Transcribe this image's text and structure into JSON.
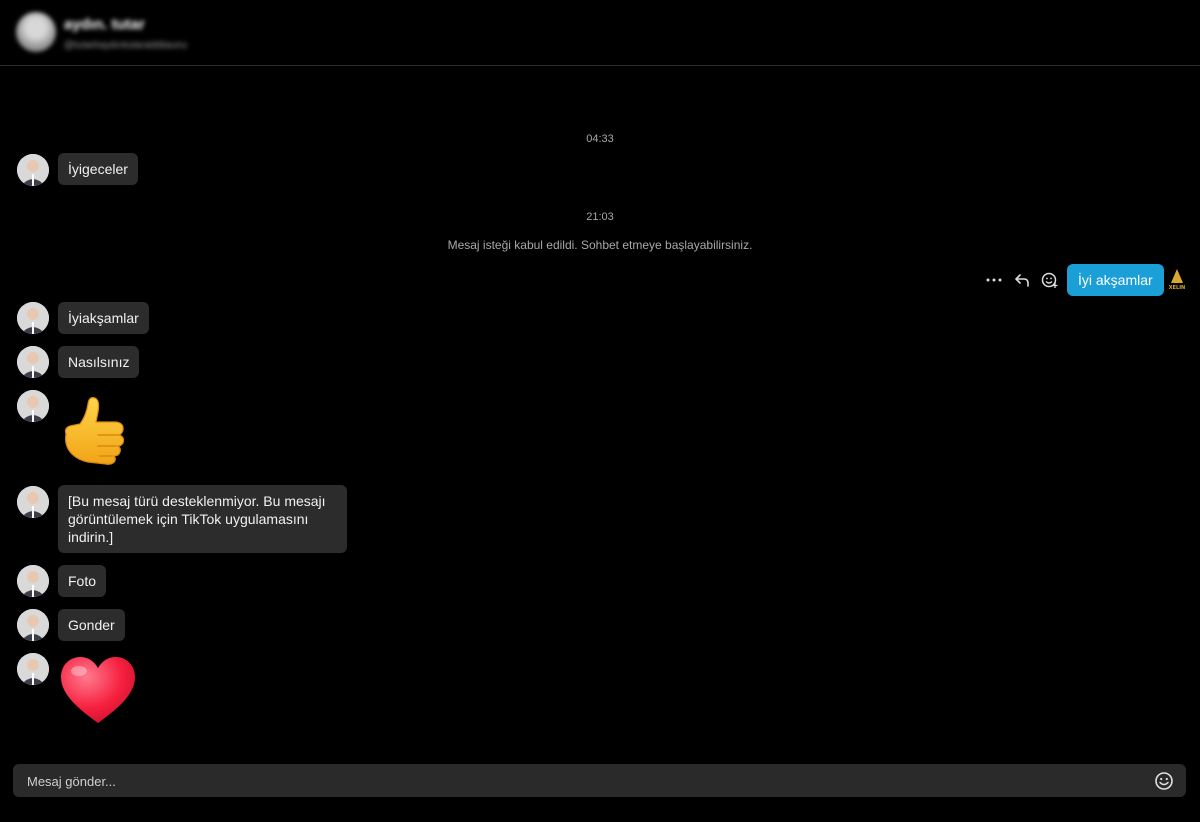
{
  "header": {
    "name": "aydın. tutar",
    "handle": "@tutarlıaydıntutaraiddiaunu"
  },
  "conversation": {
    "timestamp_1": "04:33",
    "timestamp_2": "21:03",
    "system_message": "Mesaj isteği kabul edildi. Sohbet etmeye başlayabilirsiniz.",
    "messages": [
      {
        "text": "İyigeceler"
      },
      {
        "text": "İyiakşamlar"
      },
      {
        "text": "Nasılsınız"
      },
      {
        "emoji": "thumbs-up"
      },
      {
        "text": "[Bu mesaj türü desteklenmiyor. Bu mesajı görüntülemek için TikTok uygulamasını indirin.]"
      },
      {
        "text": "Foto"
      },
      {
        "text": "Gonder"
      },
      {
        "emoji": "red-heart"
      }
    ],
    "sent_message": "İyi akşamlar",
    "watermark_text": "XELIN"
  },
  "message_actions": {
    "icons": [
      "more-icon",
      "reply-icon",
      "add-reaction-icon"
    ]
  },
  "composer": {
    "placeholder": "Mesaj gönder..."
  },
  "colors": {
    "background": "#000000",
    "received_bubble": "#2c2c2c",
    "sent_bubble": "#1a9fd6"
  }
}
